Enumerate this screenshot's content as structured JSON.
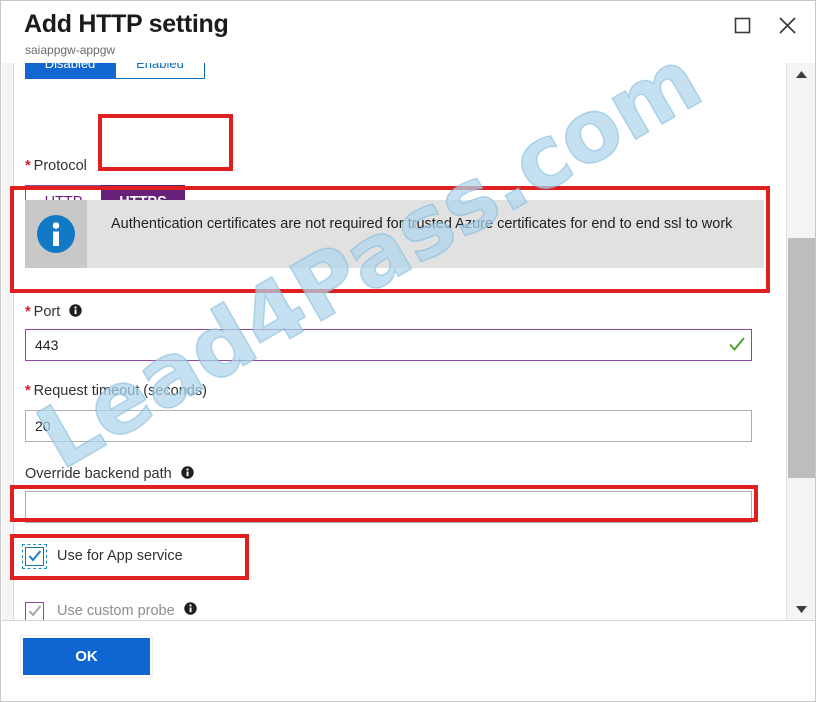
{
  "window": {
    "title": "Add HTTP setting",
    "subtitle": "saiappgw-appgw",
    "maximize_icon": "maximize-icon",
    "close_icon": "close-icon"
  },
  "state_toggle": {
    "options": [
      "Disabled",
      "Enabled"
    ],
    "selected": "Disabled"
  },
  "protocol": {
    "label": "Protocol",
    "required_marker": "*",
    "options": [
      "HTTP",
      "HTTPS"
    ],
    "selected": "HTTPS",
    "http_label": "HTTP",
    "https_label": "HTTPS"
  },
  "info_banner": {
    "icon": "info-icon",
    "message": "Authentication certificates are not required for trusted Azure certificates for end to end ssl to work"
  },
  "port": {
    "label": "Port",
    "required_marker": "*",
    "info_icon": "info-circle-icon",
    "value": "443",
    "placeholder": "",
    "validation_icon": "checkmark-icon",
    "valid": true
  },
  "request_timeout": {
    "label": "Request timeout (seconds)",
    "required_marker": "*",
    "value": "20",
    "placeholder": ""
  },
  "override_backend_path": {
    "label": "Override backend path",
    "info_icon": "info-circle-icon",
    "value": "",
    "placeholder": ""
  },
  "use_for_app_service": {
    "label": "Use for App service",
    "checked": true,
    "checkmark": "checkmark-icon"
  },
  "use_custom_probe": {
    "label": "Use custom probe",
    "checked": true,
    "disabled": true,
    "info_icon": "info-circle-icon",
    "checkmark": "checkmark-icon"
  },
  "footer": {
    "ok_label": "OK"
  },
  "scrollbar": {
    "up_icon": "chevron-up-icon",
    "down_icon": "chevron-down-icon"
  },
  "watermark": {
    "text": "Lead4Pass.com"
  },
  "colors": {
    "accent_purple": "#68217a",
    "accent_blue": "#0f66d0",
    "annotation_red": "#e02020",
    "required_red": "#cd2026",
    "valid_green": "#4ba125",
    "info_blue": "#1279c6",
    "banner_gray": "#e1e1e1",
    "watermark_blue": "#aed4ea"
  }
}
